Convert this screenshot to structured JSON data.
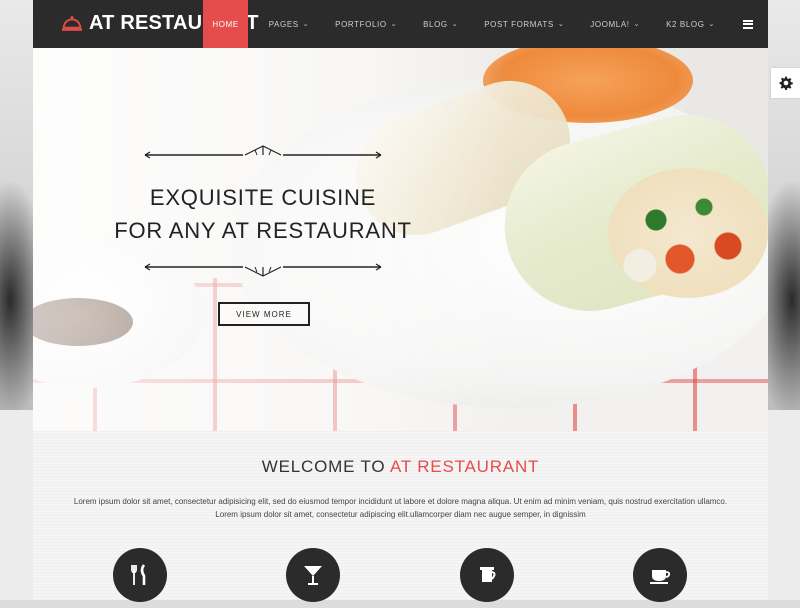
{
  "brand": {
    "name": "AT RESTAURANT",
    "accent": "#e74c4c",
    "dark": "#2b2b2b"
  },
  "nav": {
    "items": [
      {
        "label": "HOME",
        "active": true,
        "dropdown": false
      },
      {
        "label": "PAGES",
        "active": false,
        "dropdown": true
      },
      {
        "label": "PORTFOLIO",
        "active": false,
        "dropdown": true
      },
      {
        "label": "BLOG",
        "active": false,
        "dropdown": true
      },
      {
        "label": "POST FORMATS",
        "active": false,
        "dropdown": true
      },
      {
        "label": "JOOMLA!",
        "active": false,
        "dropdown": true
      },
      {
        "label": "K2 BLOG",
        "active": false,
        "dropdown": true
      }
    ],
    "menu_icon": "hamburger-icon"
  },
  "hero": {
    "headline_line1": "EXQUISITE CUISINE",
    "headline_line2": "FOR ANY AT RESTAURANT",
    "button_label": "VIEW MORE"
  },
  "settings_icon": "gear-icon",
  "welcome": {
    "title_prefix": "WELCOME TO",
    "title_highlight": "AT RESTAURANT",
    "body": "Lorem ipsum dolor sit amet, consectetur adipisicing elit, sed do eiusmod tempor incididunt ut labore et dolore magna aliqua. Ut enim ad minim veniam, quis nostrud exercitation ullamco. Lorem ipsum dolor sit amet, consectetur adipiscing elit.ullamcorper diam nec augue semper, in dignissim",
    "feature_icons": [
      "cutlery-icon",
      "cocktail-icon",
      "coffee-pot-icon",
      "coffee-cup-icon"
    ]
  }
}
